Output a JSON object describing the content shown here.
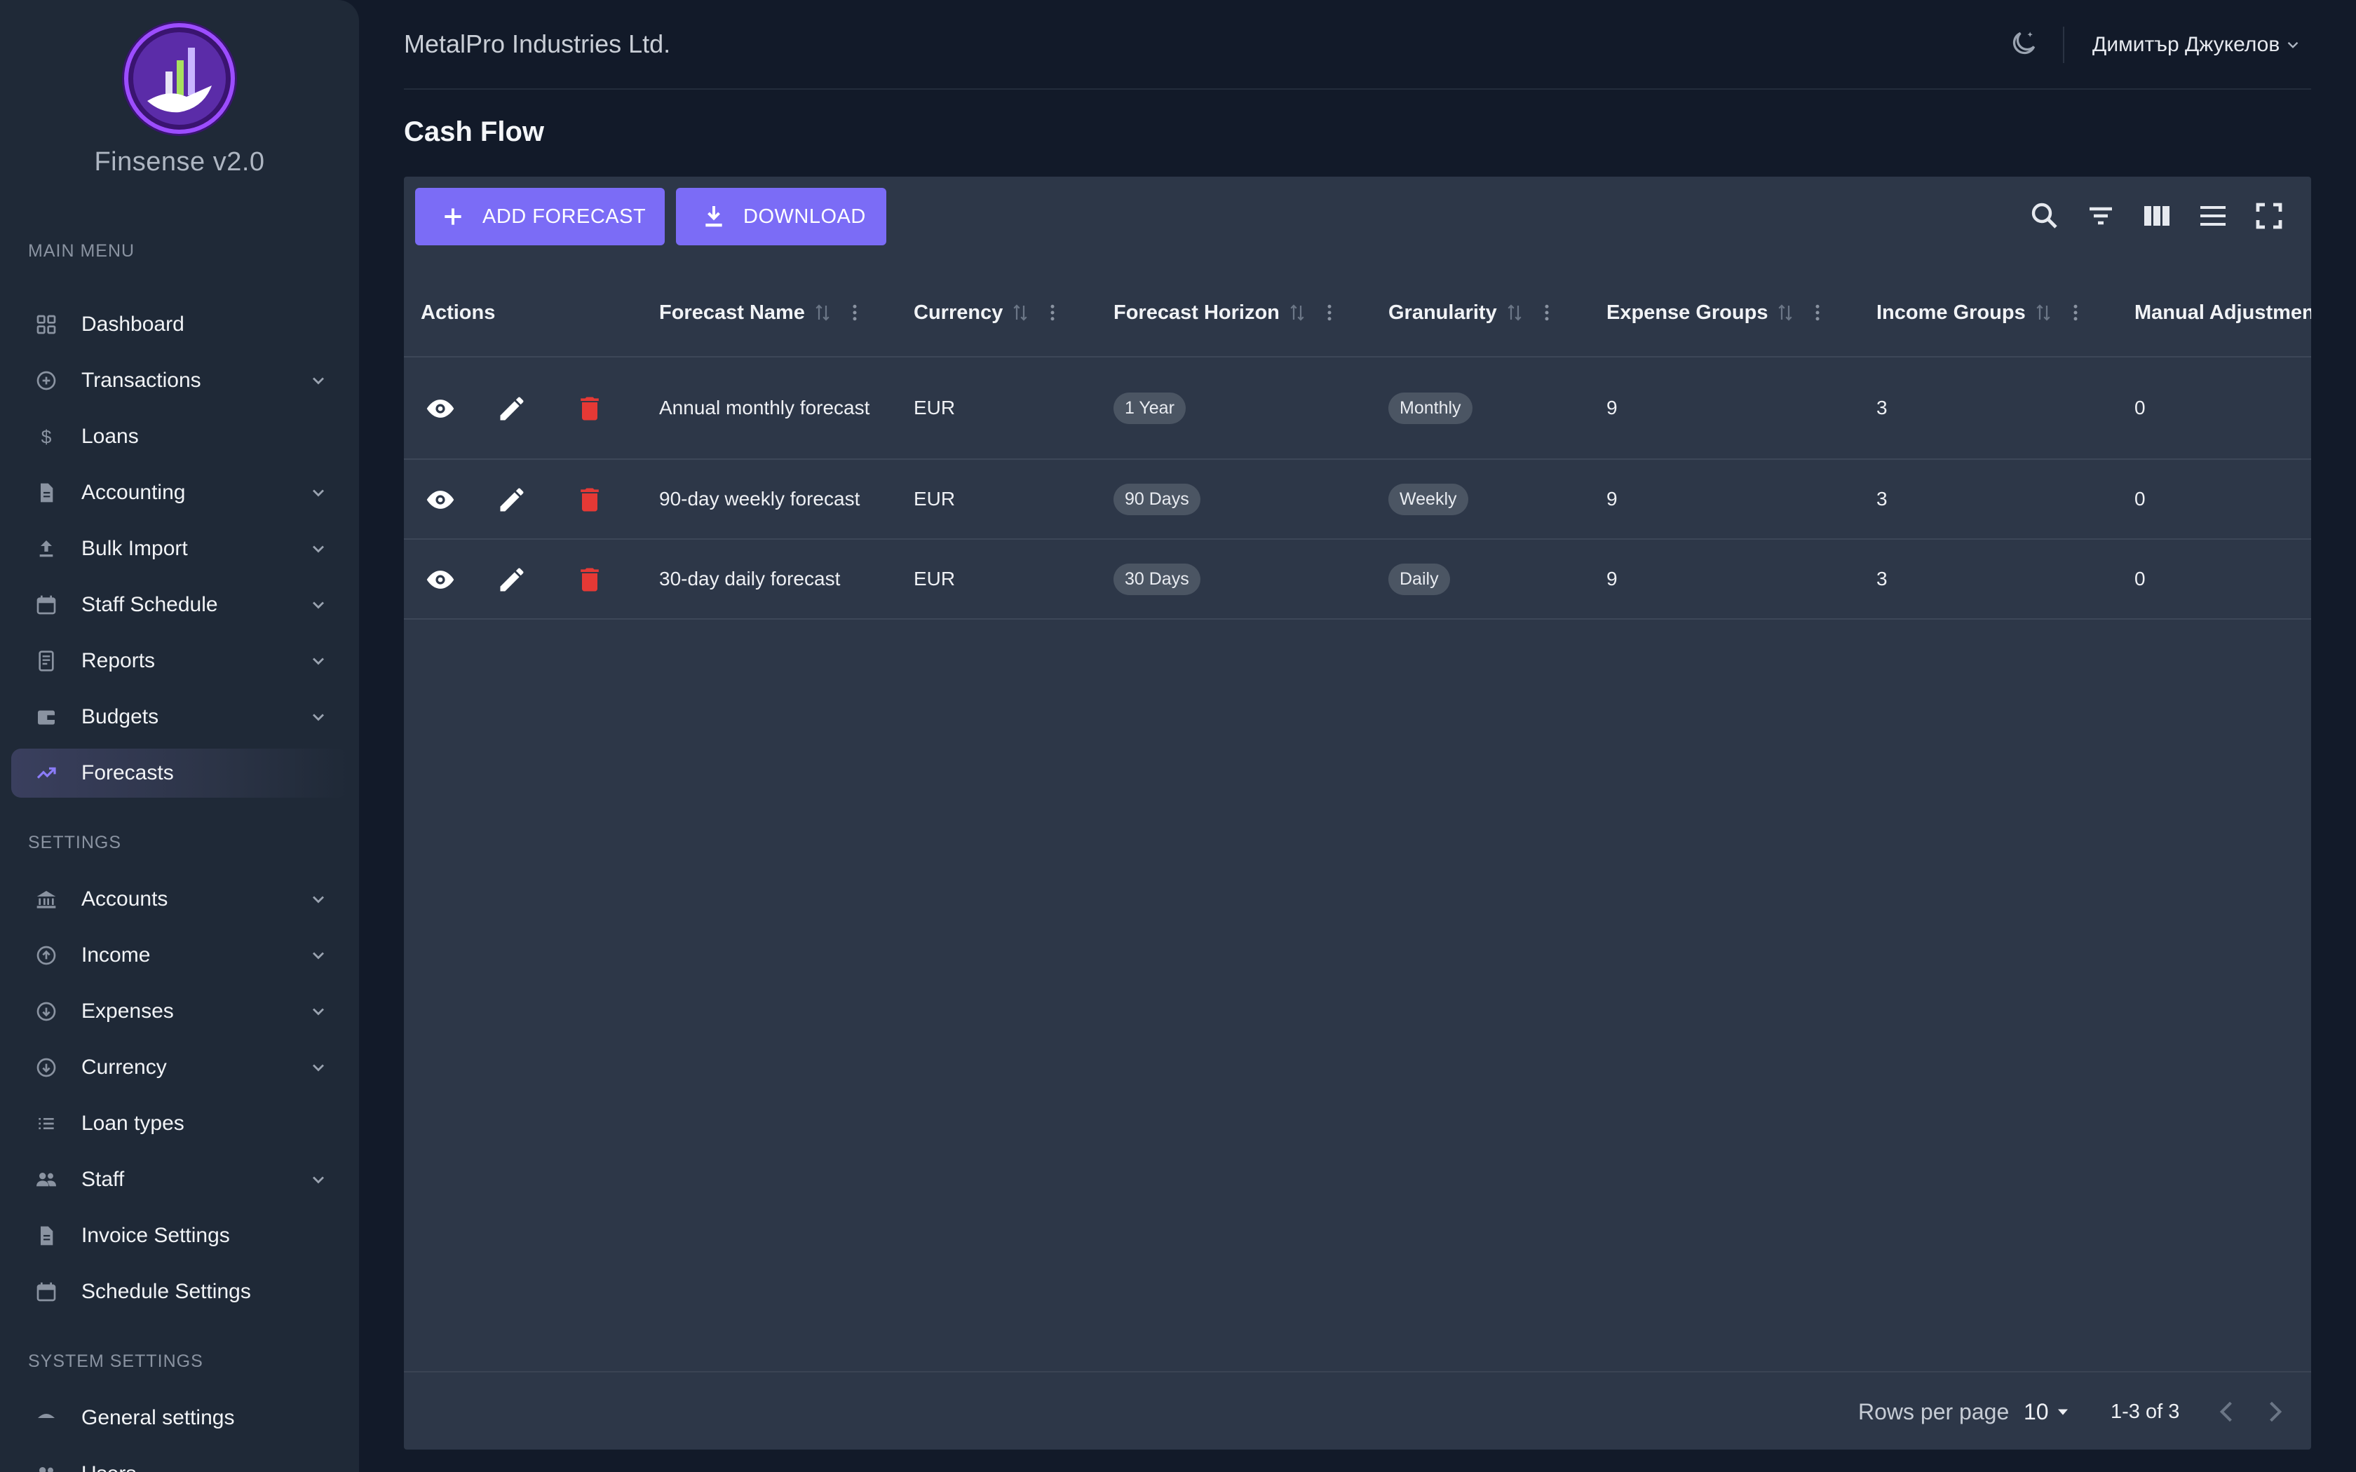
{
  "app": {
    "brand": "Finsense v2.0",
    "company": "MetalPro Industries Ltd.",
    "user_name": "Димитър Джукелов"
  },
  "sidebar": {
    "main_menu_title": "MAIN MENU",
    "main_items": [
      {
        "label": "Dashboard",
        "icon": "dashboard-icon",
        "has_submenu": false
      },
      {
        "label": "Transactions",
        "icon": "plus-circle-icon",
        "has_submenu": true
      },
      {
        "label": "Loans",
        "icon": "dollar-icon",
        "has_submenu": false
      },
      {
        "label": "Accounting",
        "icon": "document-icon",
        "has_submenu": true
      },
      {
        "label": "Bulk Import",
        "icon": "upload-icon",
        "has_submenu": true
      },
      {
        "label": "Staff Schedule",
        "icon": "calendar-icon",
        "has_submenu": true
      },
      {
        "label": "Reports",
        "icon": "report-icon",
        "has_submenu": true
      },
      {
        "label": "Budgets",
        "icon": "wallet-icon",
        "has_submenu": true
      },
      {
        "label": "Forecasts",
        "icon": "trending-up-icon",
        "has_submenu": false,
        "active": true
      }
    ],
    "settings_title": "SETTINGS",
    "settings_items": [
      {
        "label": "Accounts",
        "icon": "bank-icon",
        "has_submenu": true
      },
      {
        "label": "Income",
        "icon": "arrow-up-circle-icon",
        "has_submenu": true
      },
      {
        "label": "Expenses",
        "icon": "arrow-down-circle-icon",
        "has_submenu": true
      },
      {
        "label": "Currency",
        "icon": "arrow-down-circle-icon",
        "has_submenu": true
      },
      {
        "label": "Loan types",
        "icon": "list-icon",
        "has_submenu": false
      },
      {
        "label": "Staff",
        "icon": "people-icon",
        "has_submenu": true
      },
      {
        "label": "Invoice Settings",
        "icon": "document-icon",
        "has_submenu": false
      },
      {
        "label": "Schedule Settings",
        "icon": "calendar-icon",
        "has_submenu": false
      }
    ],
    "system_title": "SYSTEM SETTINGS",
    "system_items": [
      {
        "label": "General settings",
        "icon": "settings-icon",
        "has_submenu": false
      },
      {
        "label": "Users",
        "icon": "people-icon",
        "has_submenu": false
      }
    ]
  },
  "page": {
    "title": "Cash Flow"
  },
  "toolbar": {
    "add_label": "ADD FORECAST",
    "download_label": "DOWNLOAD"
  },
  "table": {
    "columns": [
      "Actions",
      "Forecast Name",
      "Currency",
      "Forecast Horizon",
      "Granularity",
      "Expense Groups",
      "Income Groups",
      "Manual Adjustmen"
    ],
    "rows": [
      {
        "name": "Annual monthly forecast",
        "currency": "EUR",
        "horizon": "1 Year",
        "granularity": "Monthly",
        "expense_groups": "9",
        "income_groups": "3",
        "manual_adjustments": "0"
      },
      {
        "name": "90-day weekly forecast",
        "currency": "EUR",
        "horizon": "90 Days",
        "granularity": "Weekly",
        "expense_groups": "9",
        "income_groups": "3",
        "manual_adjustments": "0"
      },
      {
        "name": "30-day daily forecast",
        "currency": "EUR",
        "horizon": "30 Days",
        "granularity": "Daily",
        "expense_groups": "9",
        "income_groups": "3",
        "manual_adjustments": "0"
      }
    ]
  },
  "pagination": {
    "rows_per_page_label": "Rows per page",
    "rows_per_page_value": "10",
    "range_text": "1-3 of 3"
  },
  "colors": {
    "accent": "#7b6cf6",
    "delete": "#e53935",
    "sidebar_bg": "#1f2937",
    "panel_bg": "#2d3748",
    "page_bg": "#121a29"
  }
}
